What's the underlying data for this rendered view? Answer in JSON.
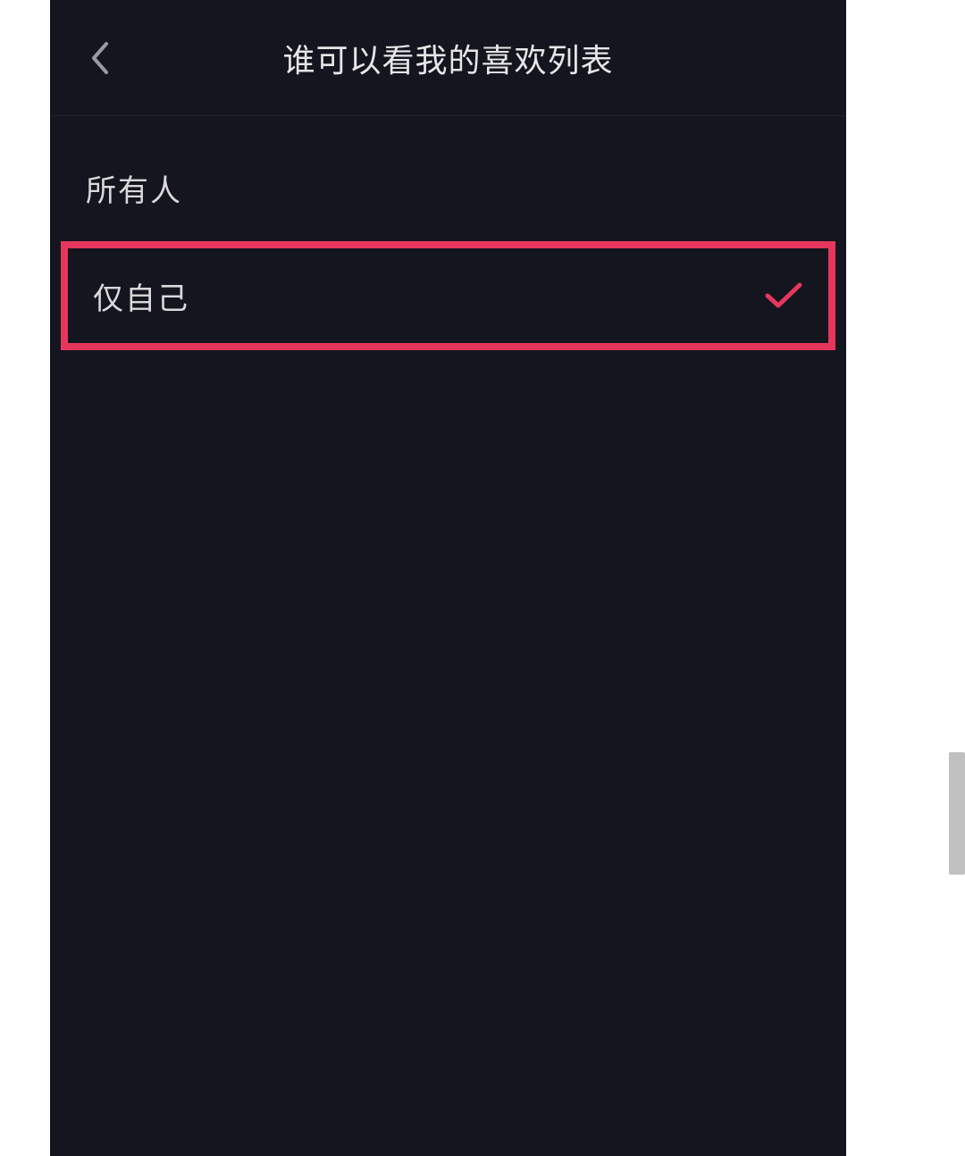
{
  "header": {
    "title": "谁可以看我的喜欢列表"
  },
  "options": [
    {
      "label": "所有人",
      "selected": false,
      "highlighted": false
    },
    {
      "label": "仅自己",
      "selected": true,
      "highlighted": true
    }
  ],
  "colors": {
    "highlight": "#e7365d",
    "check": "#e7365d",
    "background": "#14151e",
    "text": "#d9d9db"
  }
}
